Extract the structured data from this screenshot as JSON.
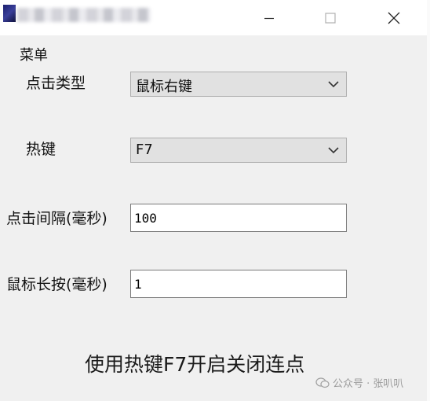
{
  "window": {
    "title": ""
  },
  "menu": {
    "label": "菜单"
  },
  "form": {
    "click_type": {
      "label": "点击类型",
      "value": "鼠标右键"
    },
    "hotkey": {
      "label": "热键",
      "value": "F7"
    },
    "click_interval": {
      "label": "点击间隔(毫秒)",
      "value": "100"
    },
    "long_press": {
      "label": "鼠标长按(毫秒)",
      "value": "1"
    }
  },
  "footer": {
    "hint": "使用热键F7开启关闭连点"
  },
  "watermark": {
    "text": "公众号 · 张叭叭"
  }
}
